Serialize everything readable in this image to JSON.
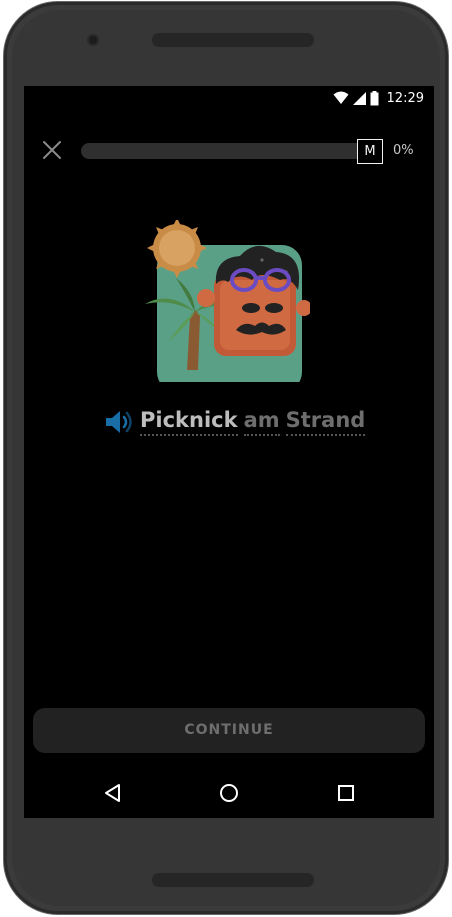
{
  "status_bar": {
    "time": "12:29",
    "icons": [
      "wifi-icon",
      "cell-signal-icon",
      "battery-icon"
    ]
  },
  "lesson": {
    "progress_percent_label": "0%",
    "progress_fraction": 0,
    "badge_label": "M"
  },
  "phrase": {
    "words": [
      "Picknick",
      "am",
      "Strand"
    ]
  },
  "footer": {
    "continue_label": "CONTINUE"
  },
  "navigation": [
    "back-icon",
    "home-icon",
    "recents-icon"
  ],
  "colors": {
    "screen_background": "#000000",
    "illustration_background": "#5fa98e",
    "speaker_icon": "#1a6ea8",
    "sun": "#c98c47",
    "palm": "#4f8c4a",
    "face": "#c35a37",
    "glasses": "#6b4bc2",
    "continue_button": "#222222"
  }
}
